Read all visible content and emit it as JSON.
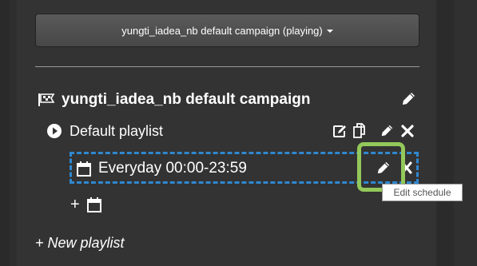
{
  "campaign_selector": {
    "label": "yungti_iadea_nb default campaign (playing)"
  },
  "campaign": {
    "title": "yungti_iadea_nb default campaign"
  },
  "playlist": {
    "title": "Default playlist"
  },
  "schedule": {
    "title": "Everyday 00:00-23:59"
  },
  "add_schedule": {
    "label": "+"
  },
  "new_playlist": {
    "label": "+ New playlist"
  },
  "tooltip": {
    "text": "Edit schedule"
  },
  "colors": {
    "schedule_border": "#2f88d0",
    "highlight": "#93c85a",
    "panel_bg": "#333333"
  },
  "icons": {
    "campaign": "flag-icon",
    "playlist": "play-circle-icon",
    "schedule": "calendar-icon",
    "edit": "pencil-icon",
    "delete": "close-icon",
    "copy": "copy-icon",
    "edit_alt": "edit-square-icon"
  }
}
